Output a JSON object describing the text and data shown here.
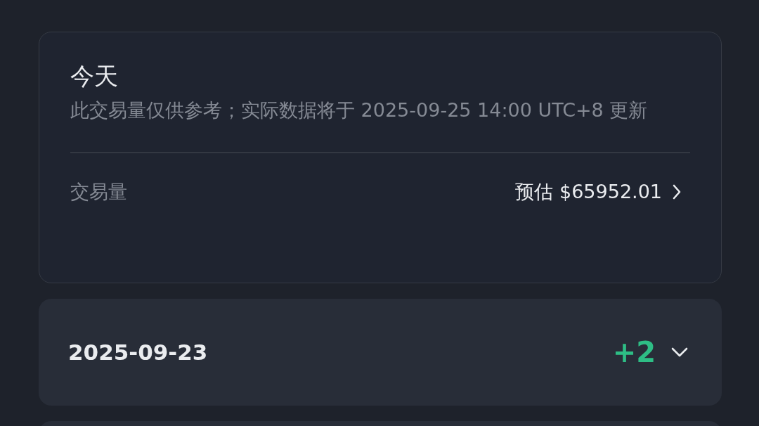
{
  "today_card": {
    "title": "今天",
    "note": "此交易量仅供参考；实际数据将于 2025-09-25 14:00 UTC+8 更新",
    "volume_label": "交易量",
    "volume_value": "预估 $65952.01"
  },
  "day_cards": [
    {
      "date": "2025-09-23",
      "change": "+2",
      "expanded": false
    }
  ]
}
